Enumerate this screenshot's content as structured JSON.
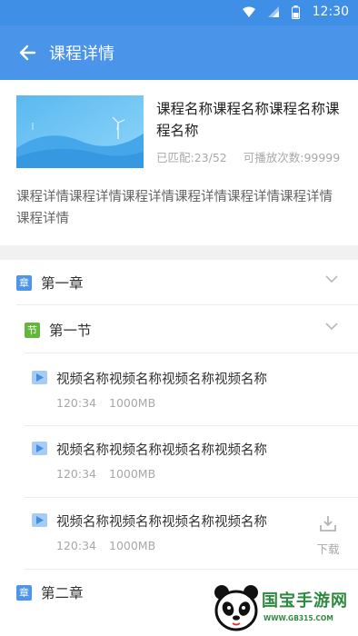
{
  "status_bar": {
    "time": "12:30"
  },
  "app_bar": {
    "title": "课程详情"
  },
  "course": {
    "name": "课程名称课程名称课程名称课程名称",
    "matched": "已匹配:23/52",
    "plays": "可播放次数:99999",
    "description": "课程详情课程详情课程详情课程详情课程详情课程详情课程详情"
  },
  "chapters": [
    {
      "tag": "章",
      "title": "第一章"
    },
    {
      "tag": "章",
      "title": "第二章"
    }
  ],
  "section": {
    "tag": "节",
    "title": "第一节"
  },
  "videos": [
    {
      "title": "视频名称视频名称视频名称视频名称",
      "duration": "120:34",
      "size": "1000MB"
    },
    {
      "title": "视频名称视频名称视频名称视频名称",
      "duration": "120:34",
      "size": "1000MB"
    },
    {
      "title": "视频名称视频名称视频名称视频名称",
      "duration": "120:34",
      "size": "1000MB"
    }
  ],
  "download": {
    "label": "下载"
  },
  "watermark": {
    "text": "国宝手游网",
    "url": "WWW.GB315.COM"
  },
  "colors": {
    "primary": "#4a94ea",
    "status_bar": "#3f8fe6",
    "chapter_tag": "#4d95ea",
    "section_tag": "#62b63c",
    "play_icon": "#a6ccf5"
  }
}
